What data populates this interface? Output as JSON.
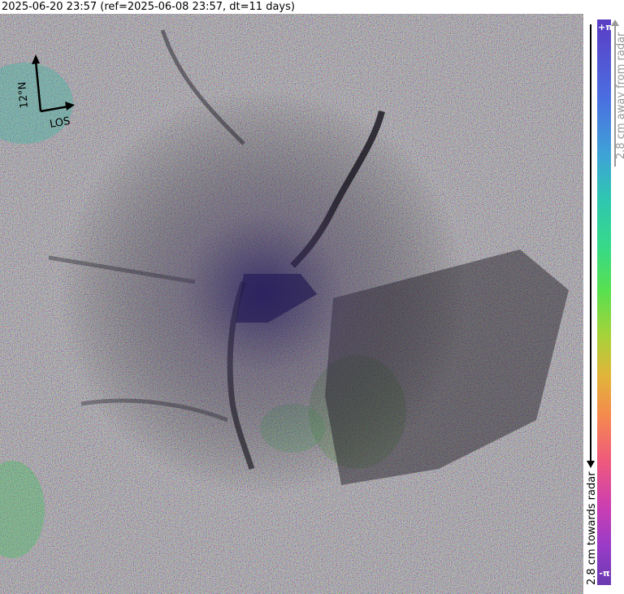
{
  "title": "2025-06-20 23:57 (ref=2025-06-08 23:57, dt=11 days)",
  "compass": {
    "north_label": "12°N",
    "los_label": "LOS"
  },
  "colorbar": {
    "top_label": "+π",
    "bottom_label": "-π",
    "away_label": "2.8 cm away from radar",
    "towards_label": "2.8 cm towards radar",
    "gradient_colors": [
      "#5b3cc4",
      "#4a6fe0",
      "#3ea3d6",
      "#2fc7b0",
      "#36d98a",
      "#58e04f",
      "#a7d23a",
      "#e1b43a",
      "#f48a4e",
      "#ef5a7c",
      "#cc3fb0",
      "#9a3bc8",
      "#6a3bb0"
    ]
  }
}
